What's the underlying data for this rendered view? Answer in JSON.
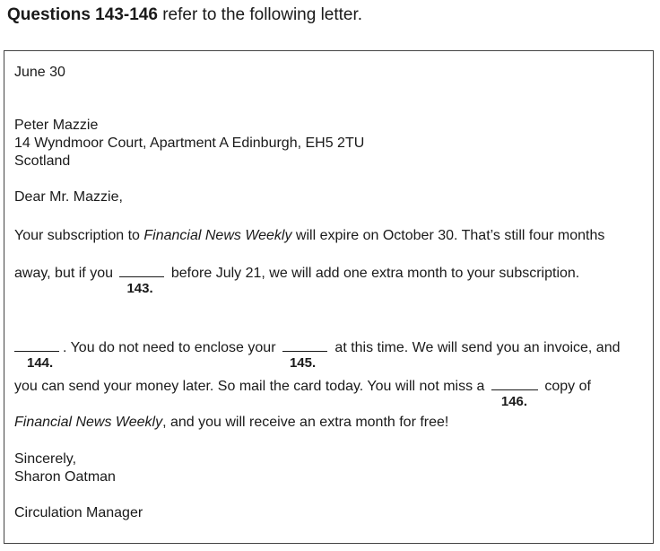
{
  "heading": {
    "bold_part": "Questions 143-146",
    "rest": " refer to the following letter."
  },
  "letter": {
    "date": "June 30",
    "recipient_name": "Peter Mazzie",
    "address_line": "14 Wyndmoor Court, Apartment A Edinburgh, EH5 2TU",
    "country": "Scotland",
    "salutation": "Dear Mr. Mazzie,",
    "para1": {
      "before": "Your subscription to ",
      "italic": "Financial News Weekly",
      "after": " will expire on October 30. That’s still four months"
    },
    "para2": {
      "before": "away, but if you ",
      "blank_number": "143.",
      "after": " before July 21, we will add one extra month to your subscription."
    },
    "para3": {
      "blank1_number": "144.",
      "middle": ". You do not need to enclose your ",
      "blank2_number": "145.",
      "after": " at this time. We will send you an invoice, and"
    },
    "para4": {
      "before": "you can send your money later. So mail the card today. You will not miss a ",
      "blank_number": "146.",
      "after": " copy of"
    },
    "para5": {
      "italic": "Financial News Weekly",
      "after": ", and you will receive an extra month for free!"
    },
    "closing": "Sincerely,",
    "signer_name": "Sharon Oatman",
    "signer_title": "Circulation Manager"
  }
}
